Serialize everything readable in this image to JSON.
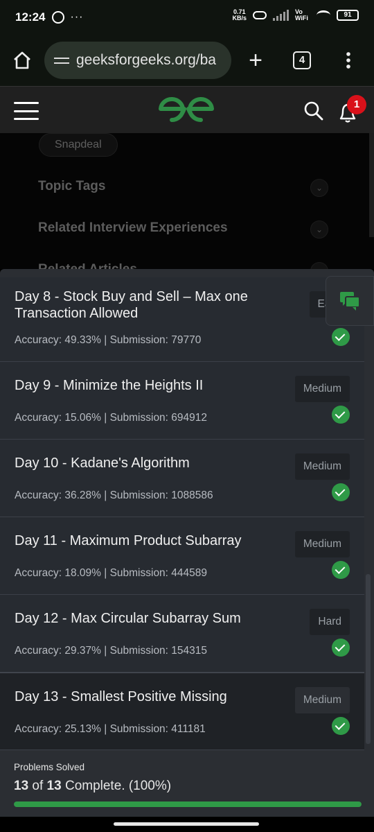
{
  "status_bar": {
    "time": "12:24",
    "more": "···",
    "net_speed": "0.71",
    "net_unit": "KB/s",
    "vowifi": "Vo WiFi",
    "battery": "91"
  },
  "browser": {
    "url": "geeksforgeeks.org/ba",
    "new_tab": "+",
    "tab_count": "4"
  },
  "header": {
    "notification_count": "1",
    "accent_color": "#2f8d46"
  },
  "background_page": {
    "company_chip": "Snapdeal",
    "rows": [
      "Topic Tags",
      "Related Interview Experiences",
      "Related Articles"
    ]
  },
  "problems": [
    {
      "title": "Day 8 - Stock Buy and Sell – Max one Transaction Allowed",
      "accuracy": "Accuracy: 49.33% | Submission: 79770",
      "difficulty": "Easy",
      "solved": true
    },
    {
      "title": "Day 9 - Minimize the Heights II",
      "accuracy": "Accuracy: 15.06% | Submission: 694912",
      "difficulty": "Medium",
      "solved": true
    },
    {
      "title": "Day 10 - Kadane's Algorithm",
      "accuracy": "Accuracy: 36.28% | Submission: 1088586",
      "difficulty": "Medium",
      "solved": true
    },
    {
      "title": "Day 11 - Maximum Product Subarray",
      "accuracy": "Accuracy: 18.09% | Submission: 444589",
      "difficulty": "Medium",
      "solved": true
    },
    {
      "title": "Day 12 - Max Circular Subarray Sum",
      "accuracy": "Accuracy: 29.37% | Submission: 154315",
      "difficulty": "Hard",
      "solved": true
    },
    {
      "title": "Day 13 - Smallest Positive Missing",
      "accuracy": "Accuracy: 25.13% | Submission: 411181",
      "difficulty": "Medium",
      "solved": true
    }
  ],
  "progress": {
    "label": "Problems Solved",
    "solved": "13",
    "of_text": " of ",
    "total": "13",
    "suffix": " Complete. (100%)",
    "fraction": 1.0
  }
}
